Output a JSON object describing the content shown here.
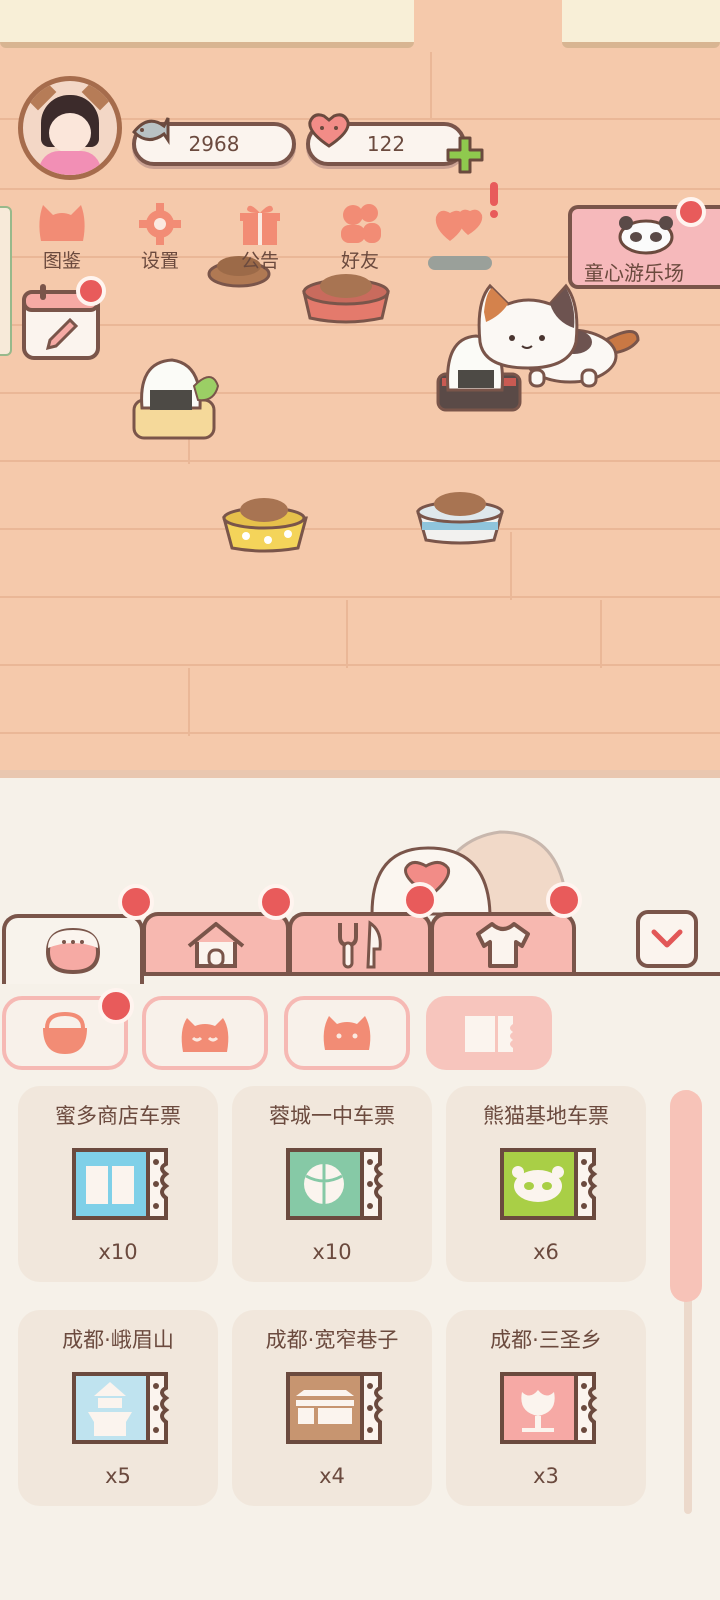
{
  "hud": {
    "fish_count": "2968",
    "heart_count": "122",
    "icons": {
      "fish": "fish-icon",
      "heart": "heart-face-icon",
      "plus": "plus-icon"
    }
  },
  "menu": [
    {
      "id": "collection",
      "label": "图鉴",
      "icon": "cat-head-icon"
    },
    {
      "id": "settings",
      "label": "设置",
      "icon": "gear-icon"
    },
    {
      "id": "announcement",
      "label": "公告",
      "icon": "gift-icon"
    },
    {
      "id": "friends",
      "label": "好友",
      "icon": "friends-icon"
    },
    {
      "id": "events",
      "label": "",
      "icon": "hearts-icon"
    }
  ],
  "park_banner": {
    "label": "童心游乐场",
    "icon": "panda-icon"
  },
  "tabs": [
    {
      "id": "food-bowl",
      "icon": "food-bowl-icon",
      "active": true
    },
    {
      "id": "house",
      "icon": "house-icon",
      "active": false
    },
    {
      "id": "utensils",
      "icon": "fork-knife-icon",
      "active": false
    },
    {
      "id": "clothes",
      "icon": "shirt-icon",
      "active": false
    }
  ],
  "subtabs": [
    {
      "id": "basket",
      "icon": "basket-icon",
      "active": false
    },
    {
      "id": "sleep",
      "icon": "sleeping-cat-icon",
      "active": false
    },
    {
      "id": "cat",
      "icon": "cat-face-icon",
      "active": false
    },
    {
      "id": "ticket",
      "icon": "ticket-icon",
      "active": true
    }
  ],
  "items": [
    {
      "title": "蜜多商店车票",
      "qty": "x10",
      "icon": "book-ticket-icon",
      "color": "#7fd0e8"
    },
    {
      "title": "蓉城一中车票",
      "qty": "x10",
      "icon": "basketball-ticket-icon",
      "color": "#86c9a6"
    },
    {
      "title": "熊猫基地车票",
      "qty": "x6",
      "icon": "panda-ticket-icon",
      "color": "#a9cf46"
    },
    {
      "title": "成都·峨眉山",
      "qty": "x5",
      "icon": "temple-ticket-icon",
      "color": "#bfe3ef"
    },
    {
      "title": "成都·宽窄巷子",
      "qty": "x4",
      "icon": "alley-ticket-icon",
      "color": "#c79570"
    },
    {
      "title": "成都·三圣乡",
      "qty": "x3",
      "icon": "flower-ticket-icon",
      "color": "#f6a9a5"
    }
  ],
  "colors": {
    "floor": "#f5c9ab",
    "accent": "#f7b8b0",
    "badge": "#e85b5b",
    "outline": "#7a554a"
  }
}
